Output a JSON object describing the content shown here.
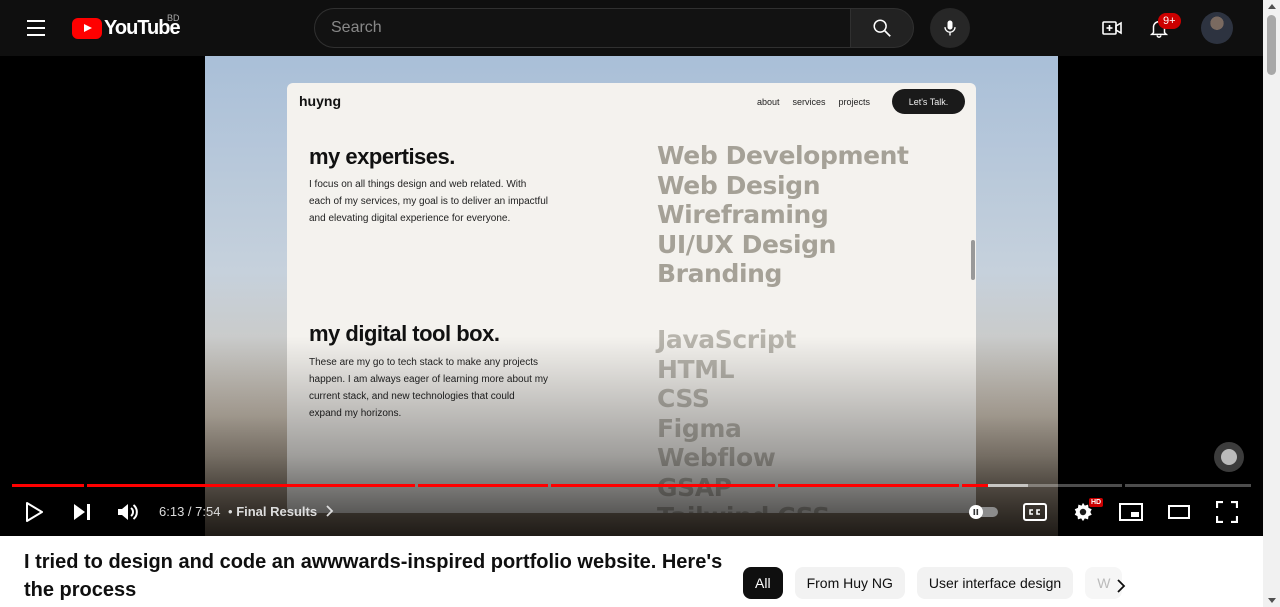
{
  "masthead": {
    "logo_text": "YouTube",
    "country_code": "BD",
    "search_placeholder": "Search",
    "notification_count": "9+"
  },
  "video_content": {
    "site_logo": "huyng",
    "nav": [
      "about",
      "services",
      "projects"
    ],
    "cta": "Let's Talk.",
    "expertise_title": "my expertises.",
    "expertise_text": "I focus on all things design and web related. With each of my services, my goal is to deliver an impactful and elevating digital experience for everyone.",
    "expertise_list": [
      "Web Development",
      "Web Design",
      "Wireframing",
      "UI/UX Design",
      "Branding"
    ],
    "toolbox_title": "my digital tool box.",
    "toolbox_text": "These are my go to tech stack to make any projects happen. I am always eager of learning more about my current stack, and new technologies that could expand my horizons.",
    "toolbox_list": [
      "JavaScript",
      "HTML",
      "CSS",
      "Figma",
      "Webflow",
      "GSAP",
      "Tailwind CSS"
    ]
  },
  "player": {
    "current_time": "6:13",
    "duration": "7:54",
    "time_display": "6:13 / 7:54",
    "chapter": "Final Results",
    "progress_fraction": 0.787,
    "hd_label": "HD"
  },
  "video": {
    "title": "I tried to design and code an awwwards-inspired portfolio website. Here's the process"
  },
  "chips": [
    "All",
    "From Huy NG",
    "User interface design",
    "W"
  ]
}
